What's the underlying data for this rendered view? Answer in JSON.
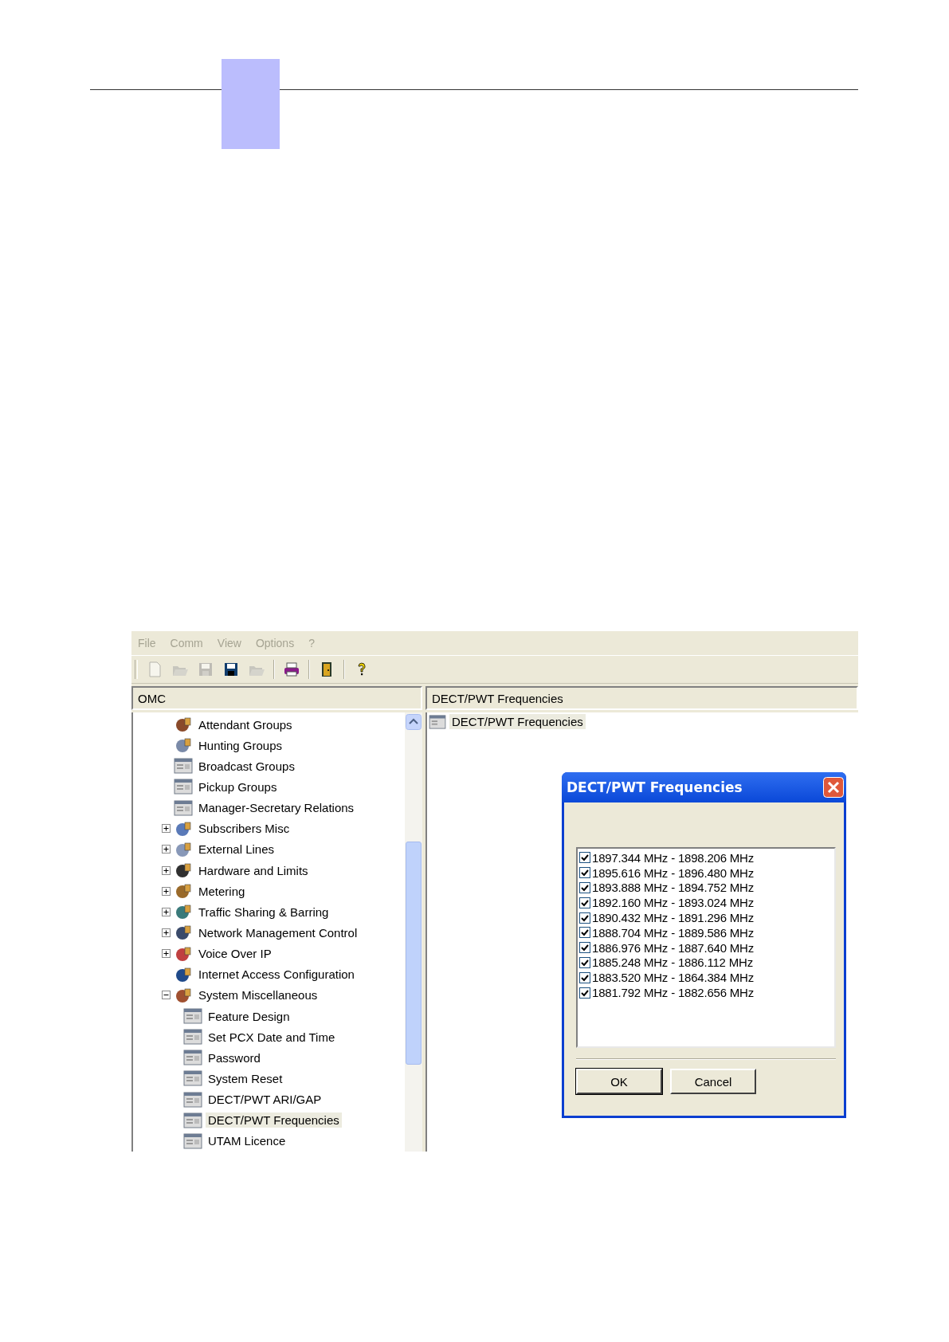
{
  "menu": [
    {
      "label": "File",
      "disabled": true
    },
    {
      "label": "Comm",
      "disabled": true
    },
    {
      "label": "View",
      "disabled": true
    },
    {
      "label": "Options",
      "disabled": true
    },
    {
      "label": "?",
      "disabled": true
    }
  ],
  "toolbar": [
    {
      "kind": "new",
      "disabled": true
    },
    {
      "kind": "open",
      "disabled": true
    },
    {
      "kind": "save",
      "disabled": true
    },
    {
      "kind": "save",
      "disabled": false
    },
    {
      "kind": "open",
      "disabled": true
    },
    {
      "kind": "print",
      "disabled": false
    },
    {
      "kind": "exit",
      "disabled": false
    },
    {
      "kind": "help",
      "disabled": false
    }
  ],
  "left_pane": {
    "title": "OMC",
    "tree": [
      {
        "label": "Attendant Groups",
        "kind": "module",
        "selected": false
      },
      {
        "label": "Hunting Groups",
        "kind": "module",
        "selected": false
      },
      {
        "label": "Broadcast Groups",
        "kind": "form",
        "selected": false
      },
      {
        "label": "Pickup Groups",
        "kind": "form",
        "selected": false
      },
      {
        "label": "Manager-Secretary Relations",
        "kind": "form",
        "selected": false
      },
      {
        "label": "Subscribers Misc",
        "kind": "module",
        "selected": false,
        "expanded": false
      },
      {
        "label": "External Lines",
        "kind": "module",
        "selected": false,
        "expanded": false
      },
      {
        "label": "Hardware and Limits",
        "kind": "module",
        "selected": false,
        "expanded": false
      },
      {
        "label": "Metering",
        "kind": "module",
        "selected": false,
        "expanded": false
      },
      {
        "label": "Traffic Sharing & Barring",
        "kind": "module",
        "selected": false,
        "expanded": false
      },
      {
        "label": "Network Management Control",
        "kind": "module",
        "selected": false,
        "expanded": false
      },
      {
        "label": "Voice Over IP",
        "kind": "module",
        "selected": false,
        "expanded": false
      },
      {
        "label": "Internet Access Configuration",
        "kind": "module",
        "selected": false
      },
      {
        "label": "System Miscellaneous",
        "kind": "module",
        "selected": false,
        "expanded": true,
        "children": [
          {
            "label": "Feature Design",
            "kind": "form",
            "selected": false
          },
          {
            "label": "Set PCX Date and Time",
            "kind": "form",
            "selected": false
          },
          {
            "label": "Password",
            "kind": "form",
            "selected": false
          },
          {
            "label": "System Reset",
            "kind": "form",
            "selected": false
          },
          {
            "label": "DECT/PWT ARI/GAP",
            "kind": "form",
            "selected": false
          },
          {
            "label": "DECT/PWT Frequencies",
            "kind": "form",
            "selected": true
          },
          {
            "label": "UTAM Licence",
            "kind": "form",
            "selected": false
          }
        ]
      }
    ]
  },
  "right_pane": {
    "title": "DECT/PWT Frequencies",
    "items": [
      {
        "label": "DECT/PWT Frequencies",
        "selected": true
      }
    ]
  },
  "dialog": {
    "title": "DECT/PWT Frequencies",
    "frequencies": [
      {
        "label": "1897.344 MHz - 1898.206 MHz",
        "checked": true
      },
      {
        "label": "1895.616 MHz - 1896.480 MHz",
        "checked": true
      },
      {
        "label": "1893.888 MHz - 1894.752 MHz",
        "checked": true
      },
      {
        "label": "1892.160 MHz - 1893.024 MHz",
        "checked": true
      },
      {
        "label": "1890.432 MHz - 1891.296 MHz",
        "checked": true
      },
      {
        "label": "1888.704 MHz - 1889.586 MHz",
        "checked": true
      },
      {
        "label": "1886.976 MHz - 1887.640 MHz",
        "checked": true
      },
      {
        "label": "1885.248 MHz - 1886.112 MHz",
        "checked": true
      },
      {
        "label": "1883.520 MHz - 1864.384 MHz",
        "checked": true
      },
      {
        "label": "1881.792 MHz - 1882.656 MHz",
        "checked": true
      }
    ],
    "buttons": [
      "OK",
      "Cancel"
    ]
  }
}
